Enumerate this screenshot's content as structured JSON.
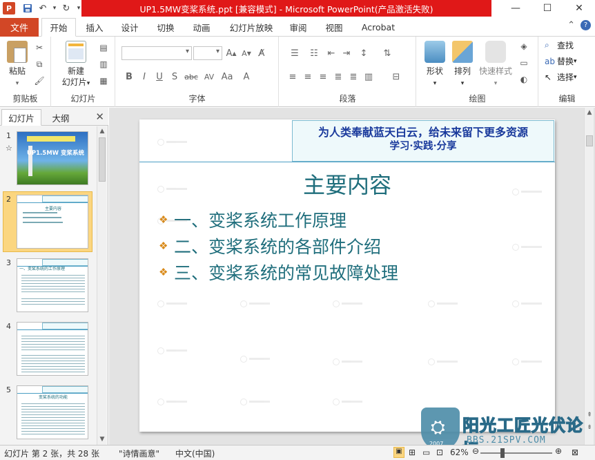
{
  "window": {
    "title": "UP1.5MW变桨系统.ppt [兼容模式] - Microsoft PowerPoint(产品激活失败)",
    "app_icon_letter": "P"
  },
  "tabs": {
    "file": "文件",
    "items": [
      "开始",
      "插入",
      "设计",
      "切换",
      "动画",
      "幻灯片放映",
      "审阅",
      "视图",
      "Acrobat"
    ]
  },
  "ribbon": {
    "clipboard": {
      "paste": "粘贴",
      "label": "剪贴板"
    },
    "slides": {
      "new_slide_l1": "新建",
      "new_slide_l2": "幻灯片",
      "label": "幻灯片"
    },
    "font": {
      "label": "字体",
      "bold": "B",
      "italic": "I",
      "underline": "U",
      "strike": "S",
      "abc": "abc",
      "av": "AV",
      "aa": "Aa",
      "a_color": "A"
    },
    "paragraph": {
      "label": "段落"
    },
    "drawing": {
      "shape": "形状",
      "arrange": "排列",
      "quick_style": "快速样式",
      "label": "绘图"
    },
    "editing": {
      "find": "查找",
      "replace": "替换",
      "select": "选择",
      "label": "编辑"
    }
  },
  "left_pane": {
    "tab_slides": "幻灯片",
    "tab_outline": "大纲",
    "thumbs": [
      {
        "num": "1",
        "title": "UP1.5MW 变桨系统"
      },
      {
        "num": "2",
        "title": "主要内容"
      },
      {
        "num": "3",
        "title": "一、变桨系统的工作原理"
      },
      {
        "num": "4",
        "title": ""
      },
      {
        "num": "5",
        "title": "变桨系统的功能"
      }
    ]
  },
  "slide": {
    "banner_line1": "为人类奉献蓝天白云，给未来留下更多资源",
    "banner_line2": "学习·实践·分享",
    "title": "主要内容",
    "bullets": [
      "一、变桨系统工作原理",
      "二、变桨系统的各部件介绍",
      "三、变桨系统的常见故障处理"
    ]
  },
  "site_logo": {
    "name": "阳光工匠光伏论坛",
    "url": "BBS.21SPV.COM",
    "year": "2007"
  },
  "status_bar": {
    "slide_info": "幻灯片 第 2 张，共 28 张",
    "theme": "\"诗情画意\"",
    "language": "中文(中国)",
    "zoom": "62%",
    "zoom_level": 0.62
  },
  "colors": {
    "accent": "#d24726",
    "title_bar_highlight": "#e01818",
    "slide_text": "#1f6e7c",
    "banner_text": "#1a3a9c",
    "bullet": "#d98a1a",
    "selected_thumb": "#fbd680"
  }
}
